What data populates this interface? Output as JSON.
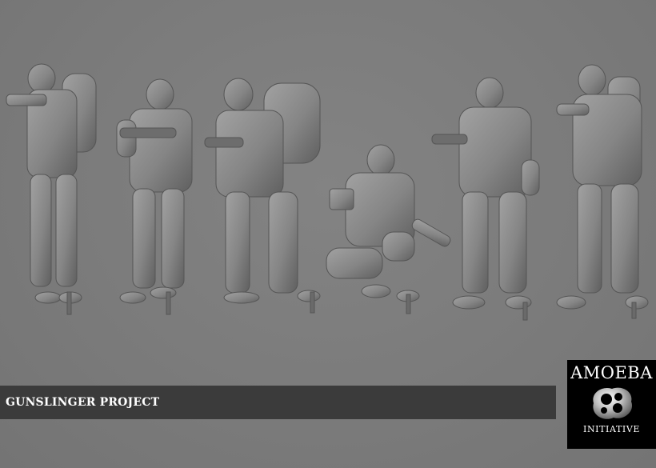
{
  "banner": {
    "title": "GUNSLINGER PROJECT"
  },
  "logo": {
    "top_text": "AMOEBA",
    "bottom_text": "INITIATIVE",
    "icon": "amoeba-logo-icon"
  },
  "figures": [
    {
      "name": "soldier-aiming-left",
      "pose": "standing aiming rifle with backpack"
    },
    {
      "name": "soldier-headset-rifle",
      "pose": "standing holding rifle low"
    },
    {
      "name": "soldier-walking-backpack",
      "pose": "walking with rifle and large backpack"
    },
    {
      "name": "soldier-kneeling",
      "pose": "kneeling with weapon and pistol"
    },
    {
      "name": "soldier-headset-standing",
      "pose": "standing with rifle raised"
    },
    {
      "name": "soldier-aiming-right",
      "pose": "standing aiming rifle"
    }
  ],
  "colors": {
    "background": "#7a7a7a",
    "figure": "#8c8c8c",
    "banner": "#3b3b3b",
    "logo_bg": "#000000"
  }
}
